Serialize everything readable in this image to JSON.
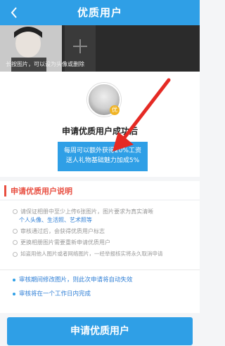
{
  "header": {
    "title": "优质用户"
  },
  "photos": {
    "note": "长按图片，可以设为头像或删除"
  },
  "profile": {
    "badge": "优",
    "headline": "申请优质用户成功后",
    "benefit_line1": "每周可以额外获得20%工资",
    "benefit_line2": "送人礼物基础魅力加成5%"
  },
  "section": {
    "title": "申请优质用户说明"
  },
  "description": {
    "line1": "请保证相册中至少上传6张图片，图片要求为真实清晰",
    "line2": "个人头像、生活照、艺术照等",
    "line3": "审核通过后，会获得优质用户标志",
    "line4": "更换相册图片需要重新申请优质用户",
    "line5": "如盗用他人图片或者网络图片，一经举报核实将永久取消申请",
    "status1": "审核期间修改图片，则此次申请将自动失效",
    "status2": "审核将在一个工作日内完成"
  },
  "action": {
    "apply_label": "申请优质用户"
  },
  "colors": {
    "primary": "#2f9fe6",
    "section_red": "#e84e40",
    "arrow_red": "#e52a24"
  }
}
